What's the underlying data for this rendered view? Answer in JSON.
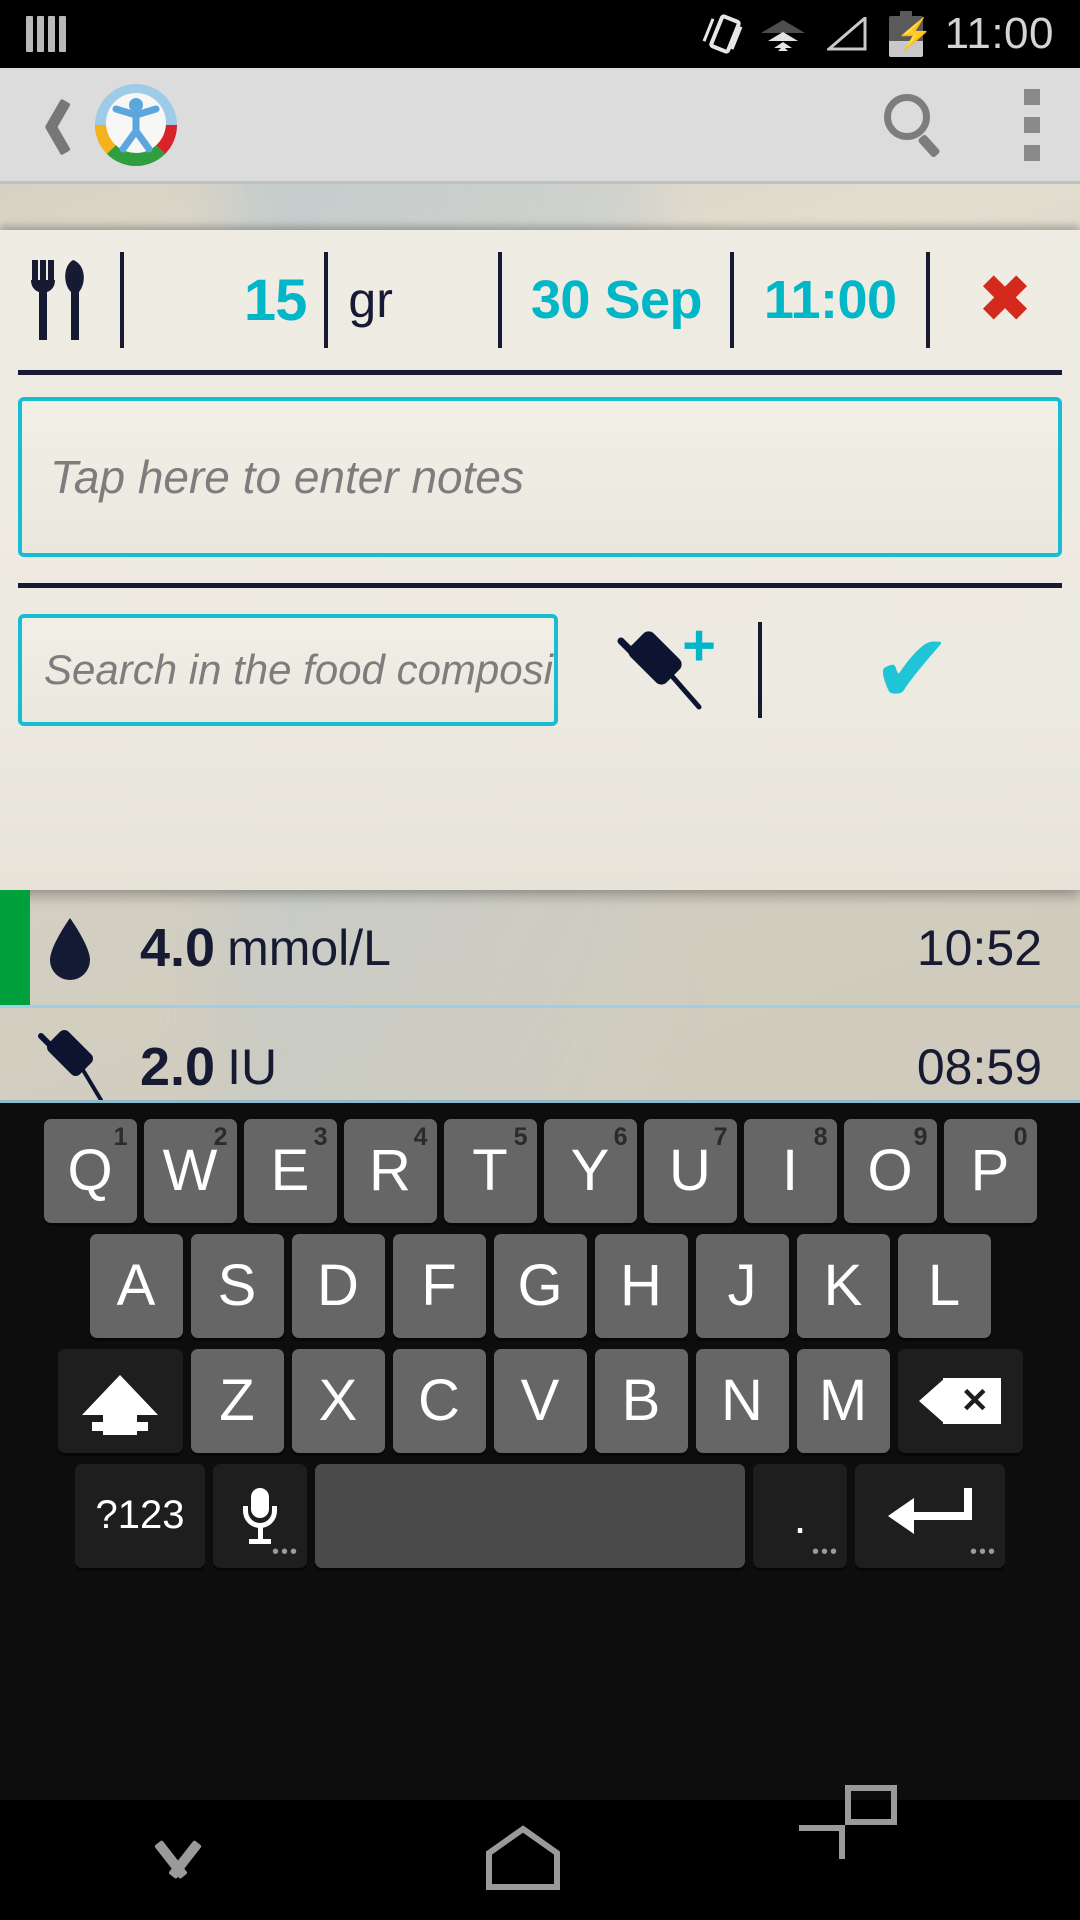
{
  "status_bar": {
    "sim_icon": "sim-bars-icon",
    "rotate_icon": "auto-rotate-icon",
    "wifi_icon": "wifi-icon",
    "signal_icon": "cellular-signal-icon",
    "battery_icon": "battery-charging-icon",
    "clock": "11:00"
  },
  "action_bar": {
    "back_icon": "back-chevron-icon",
    "app_logo": "app-logo-icon",
    "search_icon": "search-icon",
    "overflow_icon": "overflow-menu-icon"
  },
  "entry": {
    "meal_icon": "cutlery-icon",
    "amount": "15",
    "unit": "gr",
    "date": "30 Sep",
    "time": "11:00",
    "delete_label": "✖",
    "colors": {
      "accent": "#00b6c7",
      "ink": "#161b33",
      "danger": "#d42a1e",
      "border": "#18bdd4"
    }
  },
  "notes": {
    "placeholder": "Tap here to enter notes",
    "value": ""
  },
  "search": {
    "placeholder": "Search in the food composition",
    "value": "",
    "add_insulin_icon": "syringe-plus-icon",
    "confirm_label": "✔"
  },
  "list": {
    "rows": [
      {
        "icon": "blood-drop-icon",
        "value": "4.0",
        "unit": "mmol/L",
        "time": "10:52",
        "status_color": "#00a03c"
      },
      {
        "icon": "syringe-icon",
        "value": "2.0",
        "unit": "IU",
        "time": "08:59",
        "status_color": ""
      }
    ]
  },
  "keyboard": {
    "row1": [
      {
        "key": "Q",
        "num": "1"
      },
      {
        "key": "W",
        "num": "2"
      },
      {
        "key": "E",
        "num": "3"
      },
      {
        "key": "R",
        "num": "4"
      },
      {
        "key": "T",
        "num": "5"
      },
      {
        "key": "Y",
        "num": "6"
      },
      {
        "key": "U",
        "num": "7"
      },
      {
        "key": "I",
        "num": "8"
      },
      {
        "key": "O",
        "num": "9"
      },
      {
        "key": "P",
        "num": "0"
      }
    ],
    "row2": [
      "A",
      "S",
      "D",
      "F",
      "G",
      "H",
      "J",
      "K",
      "L"
    ],
    "row3": [
      "Z",
      "X",
      "C",
      "V",
      "B",
      "N",
      "M"
    ],
    "shift_icon": "shift-key-icon",
    "backspace_icon": "backspace-key-icon",
    "symbols_label": "?123",
    "mic_icon": "microphone-key-icon",
    "space_label": "",
    "period_label": ".",
    "enter_icon": "enter-key-icon",
    "longpress_hint": "•••"
  },
  "nav_bar": {
    "hide_keyboard_icon": "hide-keyboard-icon",
    "home_icon": "home-icon",
    "recents_icon": "recent-apps-icon"
  }
}
